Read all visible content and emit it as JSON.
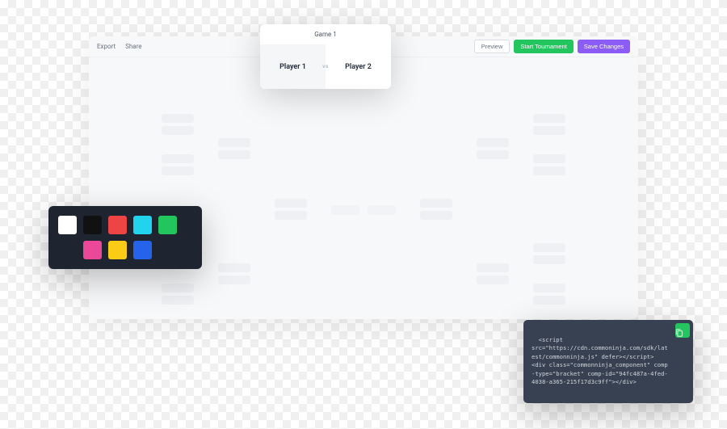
{
  "topbar": {
    "export": "Export",
    "share": "Share",
    "preview": "Preview",
    "start": "Start Tournament",
    "save": "Save Changes"
  },
  "game_card": {
    "title": "Game 1",
    "player1": "Player 1",
    "vs": "vs",
    "player2": "Player 2"
  },
  "palette": {
    "colors_row1": [
      "#ffffff",
      "#111111",
      "#ef4444",
      "#22d3ee",
      "#22c55e"
    ],
    "colors_row2": [
      "#ec4899",
      "#facc15",
      "#2563eb"
    ]
  },
  "code_snippet": {
    "text": "<script\nsrc=\"https://cdn.commoninja.com/sdk/latest/commonninja.js\" defer></script>\n<div class=\"commonninja_component\" comp-type=\"bracket\" comp-id=\"94fc487a-4fed-4038-a365-215f17d3c9ff\"></div>"
  }
}
